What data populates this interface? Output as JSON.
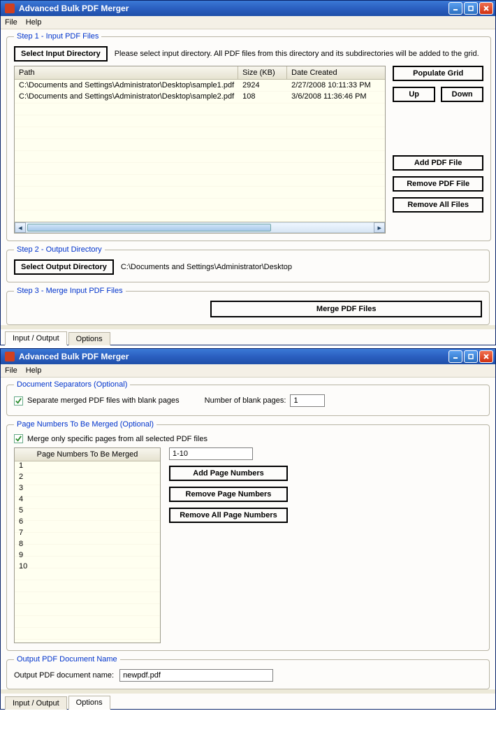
{
  "window1": {
    "title": "Advanced Bulk PDF Merger",
    "menu": {
      "file": "File",
      "help": "Help"
    },
    "step1": {
      "legend": "Step 1 - Input PDF Files",
      "select_btn": "Select Input Directory",
      "instruction": "Please select input directory. All PDF files from this directory and its subdirectories will be added to the grid.",
      "headers": {
        "path": "Path",
        "size": "Size (KB)",
        "date": "Date Created"
      },
      "rows": [
        {
          "path": "C:\\Documents and Settings\\Administrator\\Desktop\\sample1.pdf",
          "size": "2924",
          "date": "2/27/2008 10:11:33 PM"
        },
        {
          "path": "C:\\Documents and Settings\\Administrator\\Desktop\\sample2.pdf",
          "size": "108",
          "date": "3/6/2008 11:36:46 PM"
        }
      ],
      "btns": {
        "populate": "Populate Grid",
        "up": "Up",
        "down": "Down",
        "add": "Add PDF File",
        "remove": "Remove PDF File",
        "remove_all": "Remove All Files"
      }
    },
    "step2": {
      "legend": "Step 2 - Output Directory",
      "select_btn": "Select Output Directory",
      "path": "C:\\Documents and Settings\\Administrator\\Desktop"
    },
    "step3": {
      "legend": "Step 3 - Merge Input PDF Files",
      "merge_btn": "Merge PDF Files"
    },
    "tabs": {
      "io": "Input / Output",
      "options": "Options"
    }
  },
  "window2": {
    "title": "Advanced Bulk PDF Merger",
    "menu": {
      "file": "File",
      "help": "Help"
    },
    "sep": {
      "legend": "Document Separators (Optional)",
      "chk_label": "Separate merged PDF files with blank pages",
      "num_label": "Number of blank pages:",
      "num_value": "1"
    },
    "pages": {
      "legend": "Page Numbers To Be Merged (Optional)",
      "chk_label": "Merge only specific pages from all selected PDF files",
      "grid_header": "Page Numbers To Be Merged",
      "items": [
        "1",
        "2",
        "3",
        "4",
        "5",
        "6",
        "7",
        "8",
        "9",
        "10"
      ],
      "input_value": "1-10",
      "btns": {
        "add": "Add Page Numbers",
        "remove": "Remove Page Numbers",
        "remove_all": "Remove All Page Numbers"
      }
    },
    "output": {
      "legend": "Output PDF Document Name",
      "label": "Output PDF document name:",
      "value": "newpdf.pdf"
    },
    "tabs": {
      "io": "Input / Output",
      "options": "Options"
    }
  }
}
